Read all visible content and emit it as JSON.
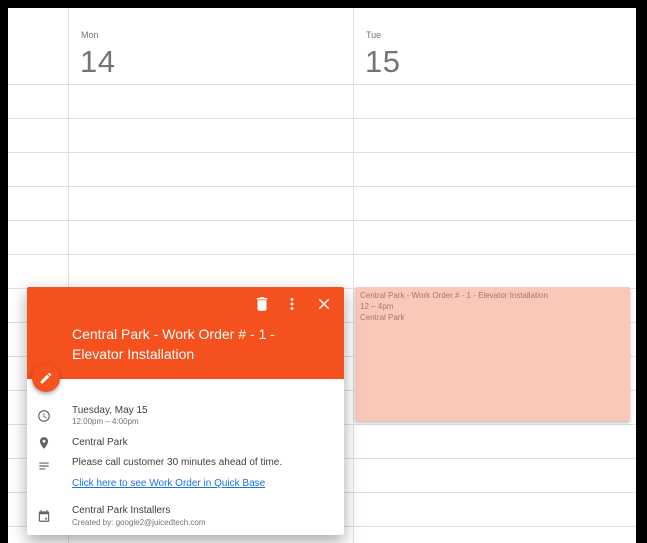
{
  "calendar": {
    "days": [
      {
        "dow": "Mon",
        "num": "14"
      },
      {
        "dow": "Tue",
        "num": "15"
      }
    ]
  },
  "event_block": {
    "title": "Central Park - Work Order # - 1 - Elevator Installation",
    "time": "12 – 4pm",
    "location": "Central Park",
    "color": "#f9c8b9"
  },
  "popup": {
    "header_color": "#f4511e",
    "title": "Central Park - Work Order # - 1 - Elevator Installation",
    "date": "Tuesday, May 15",
    "time": "12:00pm – 4:00pm",
    "location": "Central Park",
    "description": "Please call customer 30 minutes ahead of time.",
    "link": "Click here to see Work Order in Quick Base",
    "calendar_name": "Central Park Installers",
    "created_by": "Created by: google2@juicedtech.com",
    "icons": [
      "trash-icon",
      "more-vert-icon",
      "close-icon",
      "pencil-icon",
      "clock-icon",
      "location-pin-icon",
      "description-icon",
      "calendar-icon"
    ]
  }
}
